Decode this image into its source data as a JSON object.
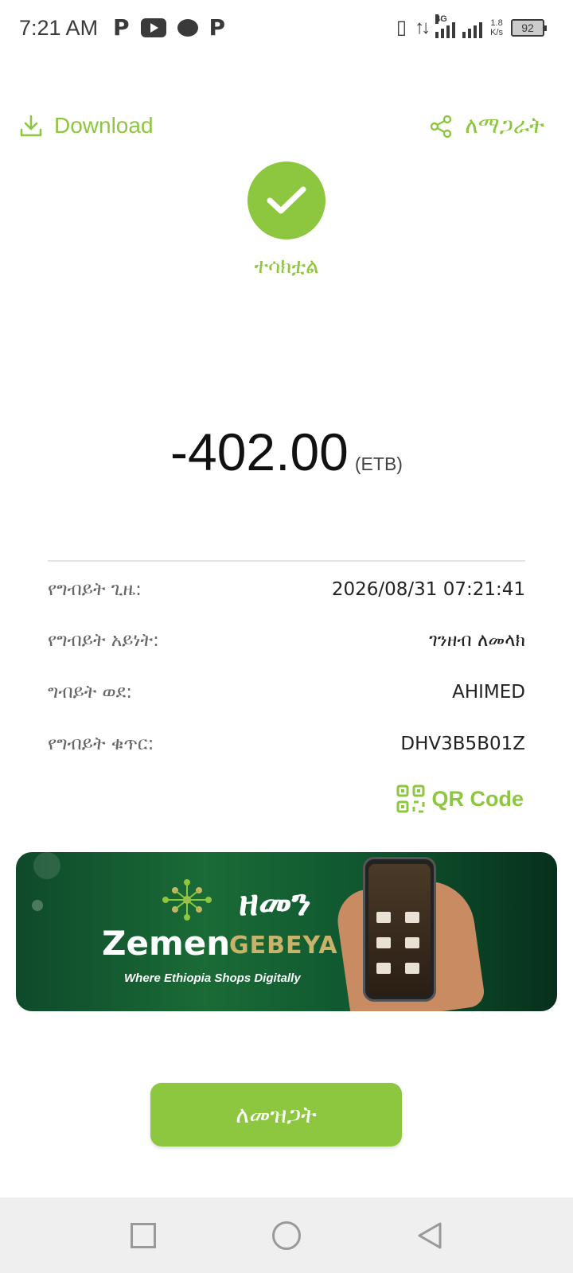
{
  "status_bar": {
    "time": "7:21 AM",
    "net_type": "4G",
    "speed_value": "1.8",
    "speed_unit": "K/s",
    "battery": "92"
  },
  "header": {
    "download_label": "Download",
    "share_label": "ለማጋራት"
  },
  "success": {
    "label": "ተሳክቷል"
  },
  "amount": {
    "value": "-402.00",
    "currency": "(ETB)"
  },
  "details": [
    {
      "label": "የግብይት ጊዜ:",
      "value": "2026/08/31 07:21:41"
    },
    {
      "label": "የግብይት አይነት:",
      "value": "ገንዘብ ለመላክ"
    },
    {
      "label": "ግብይት ወደ:",
      "value": "AHIMED"
    },
    {
      "label": "የግብይት ቁጥር:",
      "value": "DHV3B5B01Z"
    }
  ],
  "qr": {
    "label": "QR Code"
  },
  "banner": {
    "amharic_brand": "ዘመን",
    "brand_part1": "Zemen",
    "brand_part2": "GEBEYA",
    "tagline": "Where Ethiopia Shops Digitally"
  },
  "confirm": {
    "label": "ለመዝጋት"
  },
  "colors": {
    "accent": "#8dc63f",
    "banner_dark": "#0e4a2b",
    "gold": "#c9b36a"
  }
}
